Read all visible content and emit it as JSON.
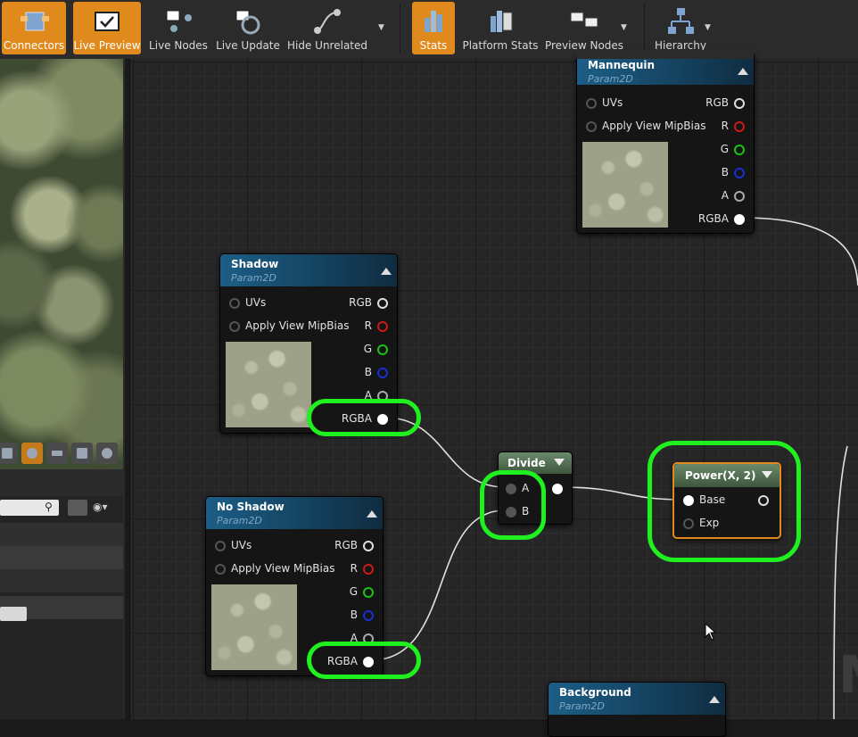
{
  "toolbar": {
    "buttons": [
      {
        "label": "Connectors",
        "icon": "connectors-icon",
        "active": true
      },
      {
        "label": "Live Preview",
        "icon": "live-preview-icon",
        "active": true
      },
      {
        "label": "Live Nodes",
        "icon": "live-nodes-icon",
        "active": false
      },
      {
        "label": "Live Update",
        "icon": "live-update-icon",
        "active": false
      },
      {
        "label": "Hide Unrelated",
        "icon": "hide-unrelated-icon",
        "active": false
      },
      {
        "label": "Stats",
        "icon": "stats-icon",
        "active": true
      },
      {
        "label": "Platform Stats",
        "icon": "platform-stats-icon",
        "active": false
      },
      {
        "label": "Preview Nodes",
        "icon": "preview-nodes-icon",
        "active": false
      },
      {
        "label": "Hierarchy",
        "icon": "hierarchy-icon",
        "active": false
      }
    ],
    "accent": "#e08a1e"
  },
  "nodes": {
    "mannequin": {
      "title": "Mannequin",
      "subtitle": "Param2D",
      "inputs": [
        "UVs",
        "Apply View MipBias"
      ],
      "outputs": [
        "RGB",
        "R",
        "G",
        "B",
        "A",
        "RGBA"
      ]
    },
    "shadow": {
      "title": "Shadow",
      "subtitle": "Param2D",
      "inputs": [
        "UVs",
        "Apply View MipBias"
      ],
      "outputs": [
        "RGB",
        "R",
        "G",
        "B",
        "A",
        "RGBA"
      ]
    },
    "no_shadow": {
      "title": "No Shadow",
      "subtitle": "Param2D",
      "inputs": [
        "UVs",
        "Apply View MipBias"
      ],
      "outputs": [
        "RGB",
        "R",
        "G",
        "B",
        "A",
        "RGBA"
      ]
    },
    "divide": {
      "title": "Divide",
      "inputs": [
        "A",
        "B"
      ]
    },
    "power": {
      "title": "Power(X, 2)",
      "inputs": [
        "Base",
        "Exp"
      ]
    },
    "background": {
      "title": "Background",
      "subtitle": "Param2D"
    }
  },
  "colors": {
    "highlight": "#1ff01f",
    "r": "#d01818",
    "g": "#18c018",
    "b": "#1830d0",
    "selected": "#e08a1e"
  }
}
